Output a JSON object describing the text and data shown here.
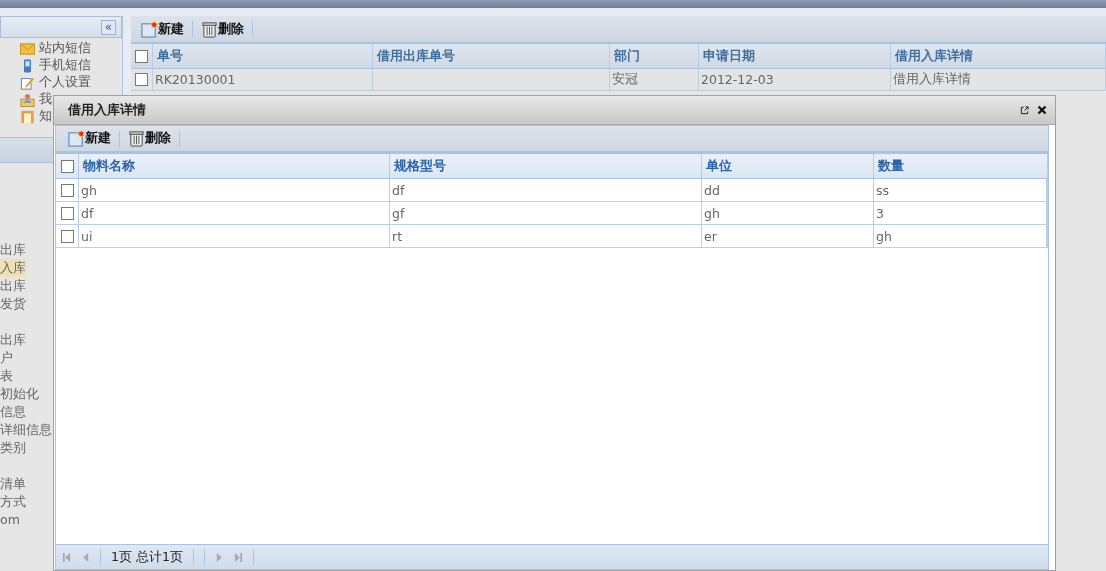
{
  "sidebar": {
    "collapse_button": "«",
    "items": [
      {
        "label": "站内短信",
        "kind": "mail"
      },
      {
        "label": "手机短信",
        "kind": "phone"
      },
      {
        "label": "个人设置",
        "kind": "settings"
      },
      {
        "label": "我",
        "kind": "work"
      },
      {
        "label": "知",
        "kind": "knowledge"
      }
    ],
    "menu_groups": [
      [
        {
          "label": "出库",
          "selected": false
        },
        {
          "label": "入库",
          "selected": true
        },
        {
          "label": "出库",
          "selected": false
        },
        {
          "label": "发货",
          "selected": false
        }
      ],
      [
        {
          "label": "出库",
          "selected": false
        },
        {
          "label": "户",
          "selected": false
        },
        {
          "label": "表",
          "selected": false
        },
        {
          "label": "初始化",
          "selected": false
        },
        {
          "label": "信息",
          "selected": false
        },
        {
          "label": "详细信息",
          "selected": false
        },
        {
          "label": "类别",
          "selected": false
        }
      ],
      [
        {
          "label": "清单",
          "selected": false
        },
        {
          "label": "方式",
          "selected": false
        },
        {
          "label": "om",
          "selected": false
        }
      ]
    ]
  },
  "toolbar": [
    {
      "label": "新建",
      "kind": "new"
    },
    {
      "label": "删除",
      "kind": "delete"
    }
  ],
  "table": {
    "select_all_checked": false,
    "columns": [
      "单号",
      "借用出库单号",
      "部门",
      "申请日期",
      "借用入库详情"
    ],
    "rows": [
      {
        "checked": false,
        "cells": [
          "RK20130001",
          "",
          "安冠",
          "2012-12-03",
          "借用入库详情"
        ]
      }
    ]
  },
  "dialog": {
    "title": "借用入库详情",
    "toolbar": [
      {
        "label": "新建",
        "kind": "new"
      },
      {
        "label": "删除",
        "kind": "delete"
      }
    ],
    "select_all_checked": false,
    "columns": [
      "物料名称",
      "规格型号",
      "单位",
      "数量"
    ],
    "rows": [
      {
        "checked": false,
        "cells": [
          "gh",
          "df",
          "dd",
          "ss"
        ]
      },
      {
        "checked": false,
        "cells": [
          "df",
          "gf",
          "gh",
          "3"
        ]
      },
      {
        "checked": false,
        "cells": [
          "ui",
          "rt",
          "er",
          "gh"
        ]
      }
    ],
    "pager": "1页 总计1页"
  }
}
